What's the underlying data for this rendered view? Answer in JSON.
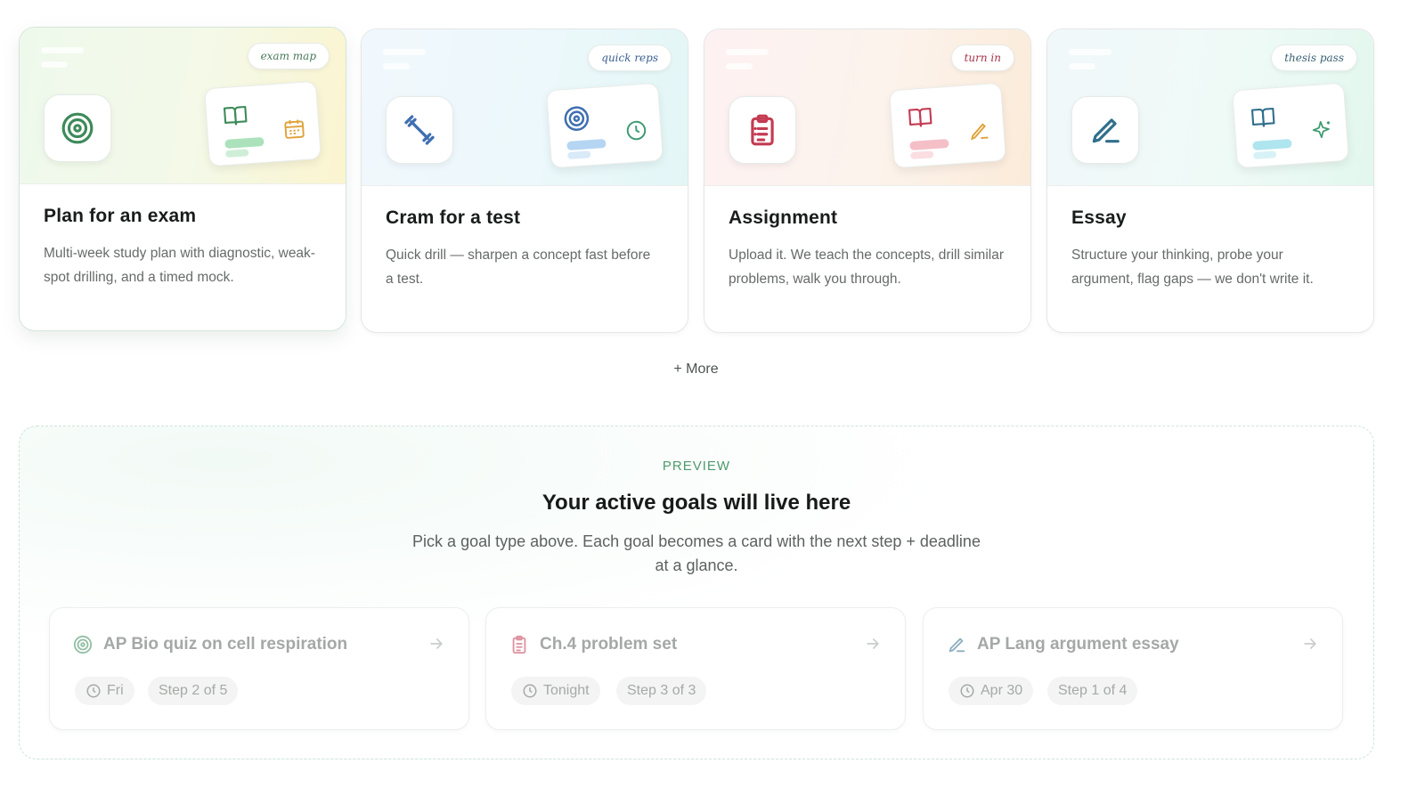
{
  "cards": [
    {
      "tag": "exam map",
      "title": "Plan for an exam",
      "desc": "Multi-week study plan with diagnostic, weak-spot drilling, and a timed mock.",
      "icon": "target-icon",
      "mini_icons": [
        "book-icon",
        "calendar-icon"
      ],
      "accent": "#3d8a5a",
      "tag_color": "#4a7a5a",
      "selected": true
    },
    {
      "tag": "quick reps",
      "title": "Cram for a test",
      "desc": "Quick drill — sharpen a concept fast before a test.",
      "icon": "dumbbell-icon",
      "mini_icons": [
        "target-icon",
        "clock-icon"
      ],
      "accent": "#3f6fb0",
      "tag_color": "#3d5f94",
      "selected": false
    },
    {
      "tag": "turn in",
      "title": "Assignment",
      "desc": "Upload it. We teach the concepts, drill similar problems, walk you through.",
      "icon": "clipboard-icon",
      "mini_icons": [
        "book-icon",
        "pencil-icon"
      ],
      "accent": "#c43a52",
      "tag_color": "#a8344a",
      "selected": false
    },
    {
      "tag": "thesis pass",
      "title": "Essay",
      "desc": "Structure your thinking, probe your argument, flag gaps — we don't write it.",
      "icon": "pen-icon",
      "mini_icons": [
        "book-icon",
        "sparkle-icon"
      ],
      "accent": "#2f6f8c",
      "tag_color": "#3a6272",
      "selected": false
    }
  ],
  "more_label": "+ More",
  "preview": {
    "eyebrow": "PREVIEW",
    "title": "Your active goals will live here",
    "subtitle": "Pick a goal type above. Each goal becomes a card with the next step + deadline at a glance.",
    "goals": [
      {
        "icon": "target-icon",
        "title": "AP Bio quiz on cell respiration",
        "deadline": "Fri",
        "step": "Step 2 of 5",
        "color": "#3d8a5a"
      },
      {
        "icon": "clipboard-icon",
        "title": "Ch.4 problem set",
        "deadline": "Tonight",
        "step": "Step 3 of 3",
        "color": "#c43a52"
      },
      {
        "icon": "pen-icon",
        "title": "AP Lang argument essay",
        "deadline": "Apr 30",
        "step": "Step 1 of 4",
        "color": "#2f6f8c"
      }
    ]
  }
}
